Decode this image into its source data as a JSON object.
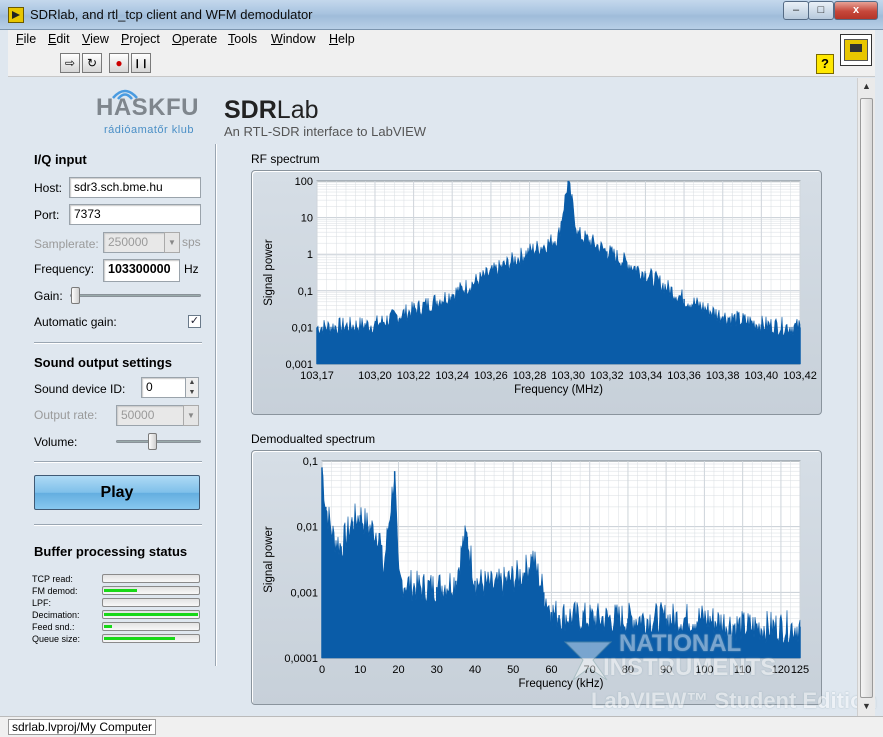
{
  "window": {
    "title": "SDRlab, and rtl_tcp client and WFM demodulator",
    "min_label": "–",
    "max_label": "□",
    "close_label": "x"
  },
  "menu": {
    "items": [
      "File",
      "Edit",
      "View",
      "Project",
      "Operate",
      "Tools",
      "Window",
      "Help"
    ]
  },
  "toolbar": {
    "run_label": "⇨",
    "run_continuous_label": "↻",
    "abort_label": "●",
    "pause_label": "❙❙",
    "help_label": "?"
  },
  "logo": {
    "main": "HASKFU",
    "sub": "rádióamatőr klub"
  },
  "brand": {
    "name_bold": "SDR",
    "name_rest": "Lab",
    "subtitle": "An RTL-SDR interface to LabVIEW"
  },
  "iq_input": {
    "title": "I/Q input",
    "host_label": "Host:",
    "host_value": "sdr3.sch.bme.hu",
    "port_label": "Port:",
    "port_value": "7373",
    "samplerate_label": "Samplerate:",
    "samplerate_value": "250000",
    "samplerate_unit": "sps",
    "frequency_label": "Frequency:",
    "frequency_value": "103300000",
    "frequency_unit": "Hz",
    "gain_label": "Gain:",
    "gain_level": 0.0,
    "auto_gain_label": "Automatic gain:",
    "auto_gain_checked": "✓"
  },
  "sound_output": {
    "title": "Sound output settings",
    "device_label": "Sound device ID:",
    "device_value": "0",
    "output_rate_label": "Output rate:",
    "output_rate_value": "50000",
    "volume_label": "Volume:",
    "volume_level": 0.48
  },
  "play_button": {
    "label": "Play"
  },
  "buffer_status": {
    "title": "Buffer processing status",
    "items": [
      {
        "label": "TCP read:",
        "level": 0.0
      },
      {
        "label": "FM demod:",
        "level": 0.35
      },
      {
        "label": "LPF:",
        "level": 0.0
      },
      {
        "label": "Decimation:",
        "level": 1.0
      },
      {
        "label": "Feed snd.:",
        "level": 0.09
      },
      {
        "label": "Queue size:",
        "level": 0.75
      }
    ]
  },
  "status_bar": {
    "text": "sdrlab.lvproj/My Computer"
  },
  "watermark": {
    "line1": "NATIONAL",
    "line2": "INSTRUMENTS",
    "line3": "LabVIEW™ Student Edition"
  },
  "colors": {
    "plot": "#0a5ca8",
    "grid": "#d8dde2",
    "meter": "#18d818"
  },
  "chart_data": [
    {
      "type": "area",
      "title": "RF spectrum",
      "xlabel": "Frequency (MHz)",
      "ylabel": "Signal power",
      "xlim": [
        103.17,
        103.42
      ],
      "ylim": [
        0.001,
        100
      ],
      "yscale": "log",
      "grid": true,
      "x_ticks": [
        "103,17",
        "103,20",
        "103,22",
        "103,24",
        "103,26",
        "103,28",
        "103,30",
        "103,32",
        "103,34",
        "103,36",
        "103,38",
        "103,40",
        "103,42"
      ],
      "x_tick_values": [
        103.17,
        103.2,
        103.22,
        103.24,
        103.26,
        103.28,
        103.3,
        103.32,
        103.34,
        103.36,
        103.38,
        103.4,
        103.42
      ],
      "y_ticks": [
        "100",
        "10",
        "1",
        "0,1",
        "0,01",
        "0,001"
      ],
      "y_tick_values": [
        100,
        10,
        1,
        0.1,
        0.01,
        0.001
      ],
      "x": [
        103.17,
        103.2,
        103.22,
        103.24,
        103.26,
        103.28,
        103.29,
        103.295,
        103.3,
        103.305,
        103.31,
        103.32,
        103.34,
        103.36,
        103.38,
        103.4,
        103.42
      ],
      "y": [
        0.01,
        0.012,
        0.03,
        0.08,
        0.3,
        1.2,
        2,
        3,
        100,
        3.5,
        2.5,
        1.2,
        0.3,
        0.06,
        0.02,
        0.012,
        0.01
      ]
    },
    {
      "type": "area",
      "title": "Demodualted spectrum",
      "xlabel": "Frequency (kHz)",
      "ylabel": "Signal power",
      "xlim": [
        0,
        125
      ],
      "ylim": [
        0.0001,
        0.1
      ],
      "yscale": "log",
      "grid": true,
      "x_ticks": [
        "0",
        "10",
        "20",
        "30",
        "40",
        "50",
        "60",
        "70",
        "80",
        "90",
        "100",
        "110",
        "120",
        "125"
      ],
      "x_tick_values": [
        0,
        10,
        20,
        30,
        40,
        50,
        60,
        70,
        80,
        90,
        100,
        110,
        120,
        125
      ],
      "y_ticks": [
        "0,1",
        "0,01",
        "0,001",
        "0,0001"
      ],
      "y_tick_values": [
        0.1,
        0.01,
        0.001,
        0.0001
      ],
      "x": [
        0,
        1,
        3,
        5,
        8,
        10,
        12,
        15,
        16,
        19,
        20,
        25,
        30,
        35,
        37,
        38,
        40,
        45,
        53,
        55,
        58,
        60,
        62,
        70,
        80,
        90,
        100,
        110,
        120,
        125
      ],
      "y": [
        0.08,
        0.02,
        0.007,
        0.005,
        0.012,
        0.015,
        0.01,
        0.008,
        0.002,
        0.07,
        0.0015,
        0.0012,
        0.0012,
        0.0015,
        0.006,
        0.007,
        0.0015,
        0.0012,
        0.002,
        0.0035,
        0.001,
        0.0005,
        0.00045,
        0.0004,
        0.0004,
        0.0004,
        0.0004,
        0.0003,
        0.0003,
        0.0003
      ]
    }
  ]
}
